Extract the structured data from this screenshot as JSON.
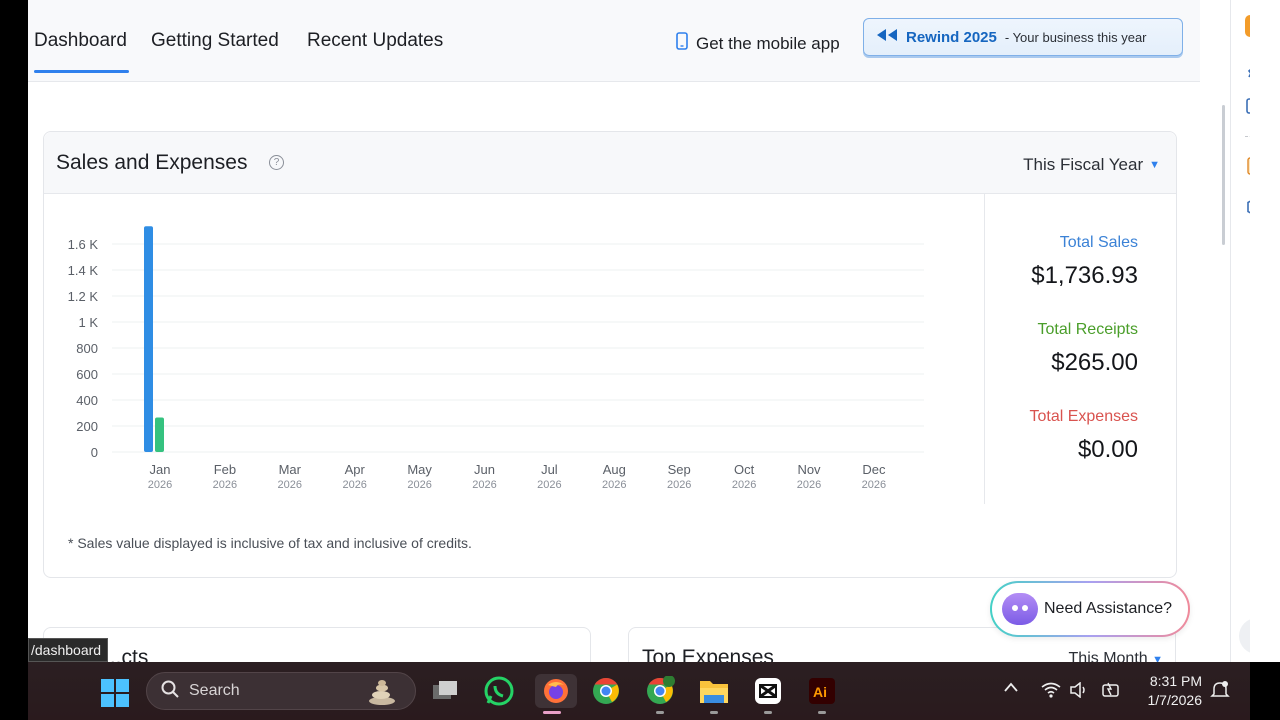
{
  "header": {
    "tabs": [
      "Dashboard",
      "Getting Started",
      "Recent Updates"
    ],
    "mobile_app_label": "Get the mobile app",
    "rewind_title": "Rewind 2025",
    "rewind_sub": "- Your business this year"
  },
  "card": {
    "title": "Sales and Expenses",
    "period": "This Fiscal Year",
    "footnote": "* Sales value displayed is inclusive of tax and inclusive of credits.",
    "totals": {
      "sales_label": "Total Sales",
      "sales_value": "$1,736.93",
      "receipts_label": "Total Receipts",
      "receipts_value": "$265.00",
      "expenses_label": "Total Expenses",
      "expenses_value": "$0.00"
    },
    "colors": {
      "sales": "#2f8de4",
      "receipts": "#35c27f",
      "sales_label": "#3b82d6",
      "receipts_label": "#4a9e2a",
      "expenses_label": "#d9534f"
    }
  },
  "chart_data": {
    "type": "bar",
    "categories": [
      "Jan",
      "Feb",
      "Mar",
      "Apr",
      "May",
      "Jun",
      "Jul",
      "Aug",
      "Sep",
      "Oct",
      "Nov",
      "Dec"
    ],
    "category_year": "2026",
    "series": [
      {
        "values": [
          1736.93,
          0,
          0,
          0,
          0,
          0,
          0,
          0,
          0,
          0,
          0,
          0
        ]
      },
      {
        "values": [
          265,
          0,
          0,
          0,
          0,
          0,
          0,
          0,
          0,
          0,
          0,
          0
        ]
      }
    ],
    "yticks": [
      0,
      200,
      400,
      600,
      800,
      1000,
      1200,
      1400,
      1600
    ],
    "ytick_labels": [
      "0",
      "200",
      "400",
      "600",
      "800",
      "1 K",
      "1.2 K",
      "1.4 K",
      "1.6 K"
    ],
    "ylim": [
      0,
      1600
    ],
    "grid": true
  },
  "lower": {
    "left_title": "...cts",
    "right_title": "Top Expenses",
    "right_period": "This Month"
  },
  "assistant": {
    "label": "Need Assistance?"
  },
  "url_tooltip": "/dashboard",
  "taskbar": {
    "search_label": "Search",
    "time": "8:31 PM",
    "date": "1/7/2026"
  }
}
